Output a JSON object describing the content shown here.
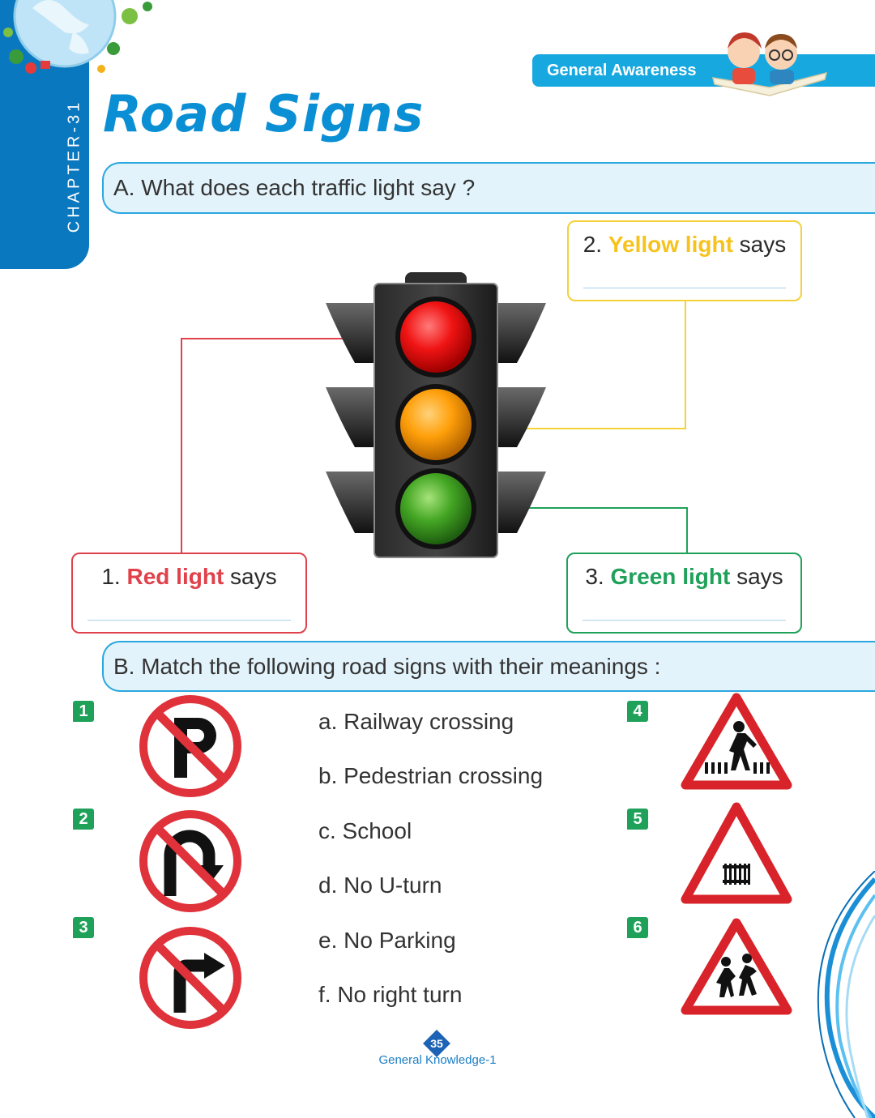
{
  "chapter": {
    "label": "CHAPTER-31"
  },
  "header": {
    "banner": "General Awareness",
    "title": "Road Signs"
  },
  "section_a": {
    "question": "A. What does each traffic light say ?",
    "boxes": [
      {
        "num": "1.",
        "color_word": "Red light",
        "suffix": "says",
        "color": "#e0414b"
      },
      {
        "num": "2.",
        "color_word": "Yellow light",
        "suffix": "says",
        "color": "#f6c21c"
      },
      {
        "num": "3.",
        "color_word": "Green light",
        "suffix": "says",
        "color": "#1fa15a"
      }
    ]
  },
  "section_b": {
    "question": "B. Match the following road signs with their meanings :",
    "numbers": [
      "1",
      "2",
      "3",
      "4",
      "5",
      "6"
    ],
    "meanings": [
      "a. Railway crossing",
      "b. Pedestrian crossing",
      "c. School",
      "d. No U-turn",
      "e. No Parking",
      "f. No right turn"
    ],
    "signs": [
      "no-parking-icon",
      "no-u-turn-icon",
      "no-right-turn-icon",
      "pedestrian-crossing-icon",
      "railway-crossing-icon",
      "school-icon"
    ]
  },
  "footer": {
    "page": "35",
    "book": "General Knowledge-1"
  },
  "colors": {
    "brand_blue": "#0a78bf",
    "sign_red": "#d8232a",
    "badge_green": "#1fa15a"
  }
}
